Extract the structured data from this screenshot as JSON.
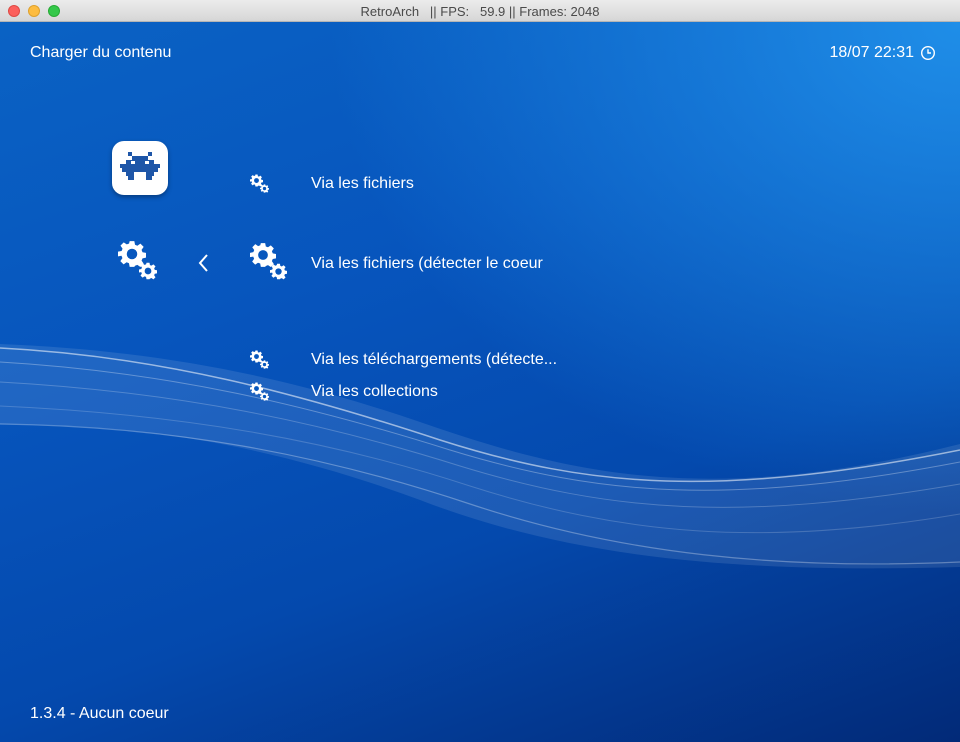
{
  "window": {
    "title": "RetroArch   || FPS:   59.9 || Frames: 2048"
  },
  "header": {
    "title": "Charger du contenu",
    "datetime": "18/07 22:31",
    "clock_icon": "clock-icon"
  },
  "sidebar": {
    "main_icon": "retroarch-logo-icon",
    "category_icon": "gears-icon",
    "back_icon": "chevron-left-icon"
  },
  "menu": {
    "items": [
      {
        "label": "Via les fichiers",
        "icon": "gears-icon",
        "selected": false
      },
      {
        "label": "Via les fichiers (détecter le coeur",
        "icon": "gears-icon",
        "selected": true
      },
      {
        "label": "Via les téléchargements (détecte...",
        "icon": "gears-icon",
        "selected": false
      },
      {
        "label": "Via les collections",
        "icon": "gears-icon",
        "selected": false
      }
    ]
  },
  "footer": {
    "status": "1.3.4 - Aucun coeur"
  },
  "colors": {
    "background_top": "#1f8ee8",
    "background_mid": "#0755bd",
    "background_bottom": "#022a78",
    "text": "#ffffff"
  }
}
